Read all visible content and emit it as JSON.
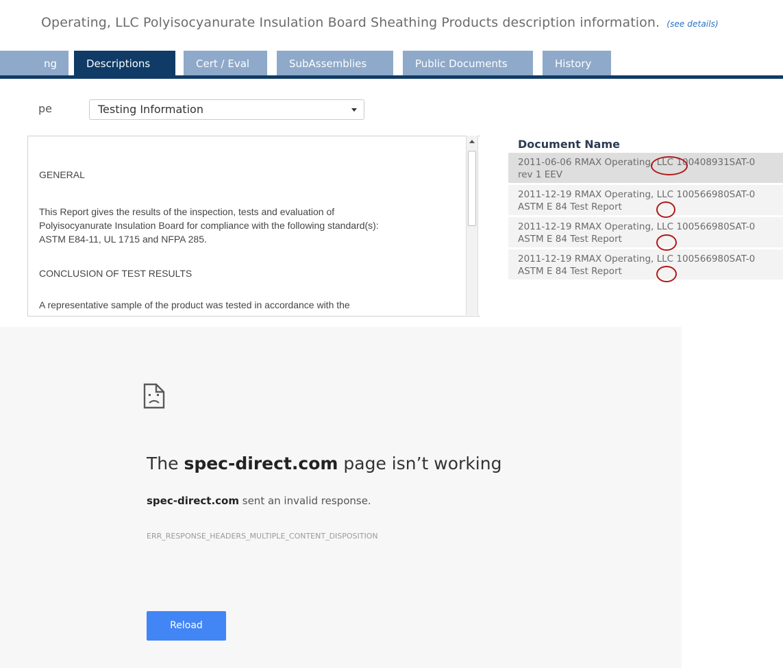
{
  "header": {
    "title": "Operating, LLC Polyisocyanurate Insulation Board Sheathing Products description information.",
    "see_details": "(see details)"
  },
  "tabs": [
    {
      "label": "ng",
      "active": false
    },
    {
      "label": "Descriptions",
      "active": true
    },
    {
      "label": "Cert / Eval",
      "active": false
    },
    {
      "label": "SubAssemblies",
      "active": false
    },
    {
      "label": "Public Documents",
      "active": false
    },
    {
      "label": "History",
      "active": false
    }
  ],
  "type_selector": {
    "label": "pe",
    "selected": "Testing Information"
  },
  "description": {
    "lines": [
      "GENERAL",
      "This Report gives the results of the inspection, tests and evaluation of\nPolyisocyanurate Insulation Board for compliance with the following standard(s):\nASTM E84-11, UL 1715 and NFPA 285.",
      "CONCLUSION OF TEST RESULTS",
      "A representative sample of the product was tested in accordance with the"
    ]
  },
  "documents": {
    "header": "Document Name",
    "rows": [
      {
        "line1": "2011-06-06 RMAX Operating, LLC 100408931SAT-0",
        "line2": "rev 1 EEV"
      },
      {
        "line1": "2011-12-19 RMAX Operating, LLC 100566980SAT-0",
        "line2": "ASTM E 84 Test Report"
      },
      {
        "line1": "2011-12-19 RMAX Operating, LLC 100566980SAT-0",
        "line2": "ASTM E 84 Test Report"
      },
      {
        "line1": "2011-12-19 RMAX Operating, LLC 100566980SAT-0",
        "line2": "ASTM E 84 Test Report"
      }
    ]
  },
  "error_page": {
    "title_prefix": "The ",
    "title_domain": "spec-direct.com",
    "title_suffix": " page isn’t working",
    "sub_domain": "spec-direct.com",
    "sub_text": " sent an invalid response.",
    "code": "ERR_RESPONSE_HEADERS_MULTIPLE_CONTENT_DISPOSITION",
    "reload_label": "Reload"
  },
  "colors": {
    "tab_active": "#0f3b66",
    "tab_inactive": "#8ea9c9",
    "annotation": "#b01818",
    "reload_button": "#4285f4"
  }
}
